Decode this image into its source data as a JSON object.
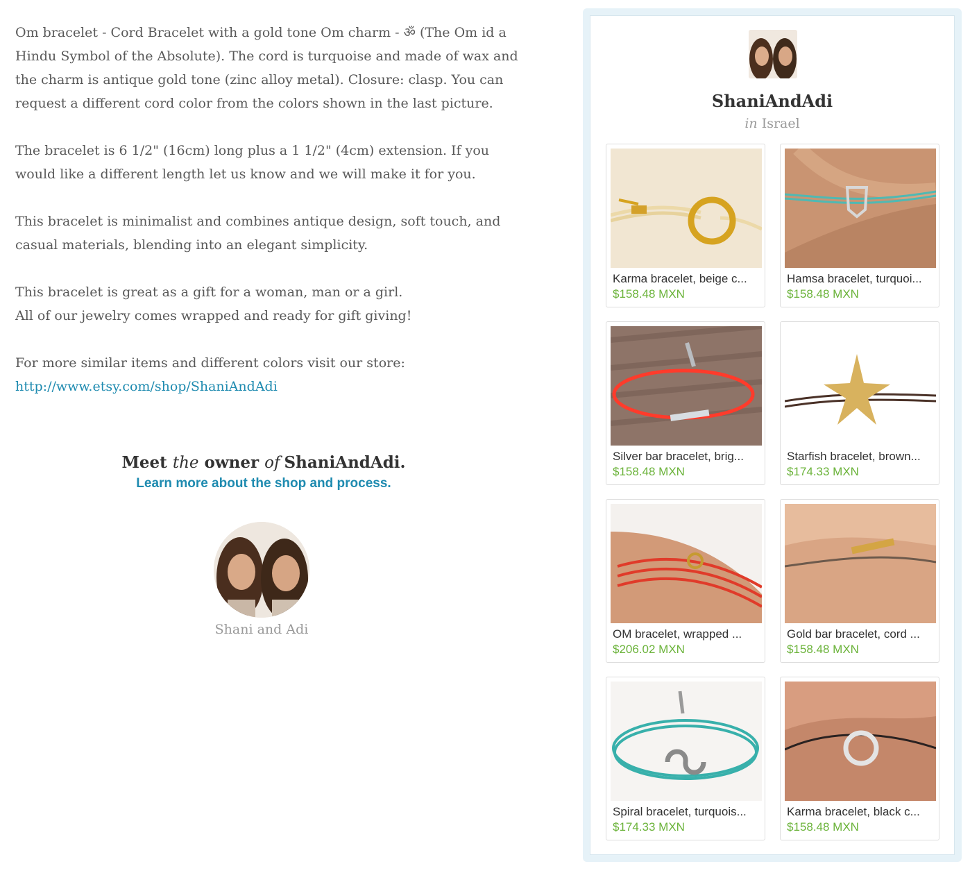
{
  "description": {
    "p1": [
      "Om bracelet - Cord Bracelet with a gold tone Om charm - ॐ (The Om id a",
      "Hindu Symbol of the Absolute). The cord is turquoise and made of wax and",
      "the charm is antique gold tone (zinc alloy metal). Closure: clasp. You can",
      "request a different cord color from the colors shown in the last picture."
    ],
    "p2": [
      "The bracelet is 6 1/2\" (16cm) long plus a 1 1/2\" (4cm) extension. If you",
      "would like a different length let us know and we will make it for you."
    ],
    "p3": [
      "This bracelet is minimalist and combines antique design, soft touch, and",
      "casual materials, blending into an elegant simplicity."
    ],
    "p4": [
      "This bracelet is great as a gift for a woman, man or a girl.",
      "All of our jewelry comes wrapped and ready for gift giving!"
    ],
    "p5": "For more similar items and different colors visit our store:",
    "store_link": "http://www.etsy.com/shop/ShaniAndAdi"
  },
  "meet": {
    "prefix": "Meet",
    "the": "the",
    "owner": "owner",
    "of": "of",
    "shop": "ShaniAndAdi.",
    "link": "Learn more about the shop and process.",
    "owner_name": "Shani and Adi"
  },
  "shop": {
    "name": "ShaniAndAdi",
    "in": "in",
    "location": "Israel"
  },
  "items": [
    {
      "title": "Karma bracelet, beige c...",
      "price": "$158.48 MXN"
    },
    {
      "title": "Hamsa bracelet, turquoi...",
      "price": "$158.48 MXN"
    },
    {
      "title": "Silver bar bracelet, brig...",
      "price": "$158.48 MXN"
    },
    {
      "title": "Starfish bracelet, brown...",
      "price": "$174.33 MXN"
    },
    {
      "title": "OM bracelet, wrapped ...",
      "price": "$206.02 MXN"
    },
    {
      "title": "Gold bar bracelet, cord ...",
      "price": "$158.48 MXN"
    },
    {
      "title": "Spiral bracelet, turquois...",
      "price": "$174.33 MXN"
    },
    {
      "title": "Karma bracelet, black c...",
      "price": "$158.48 MXN"
    }
  ],
  "colors": {
    "link": "#1f8bb0",
    "price": "#6bb33a",
    "panel_bg": "#e6f2f8"
  }
}
